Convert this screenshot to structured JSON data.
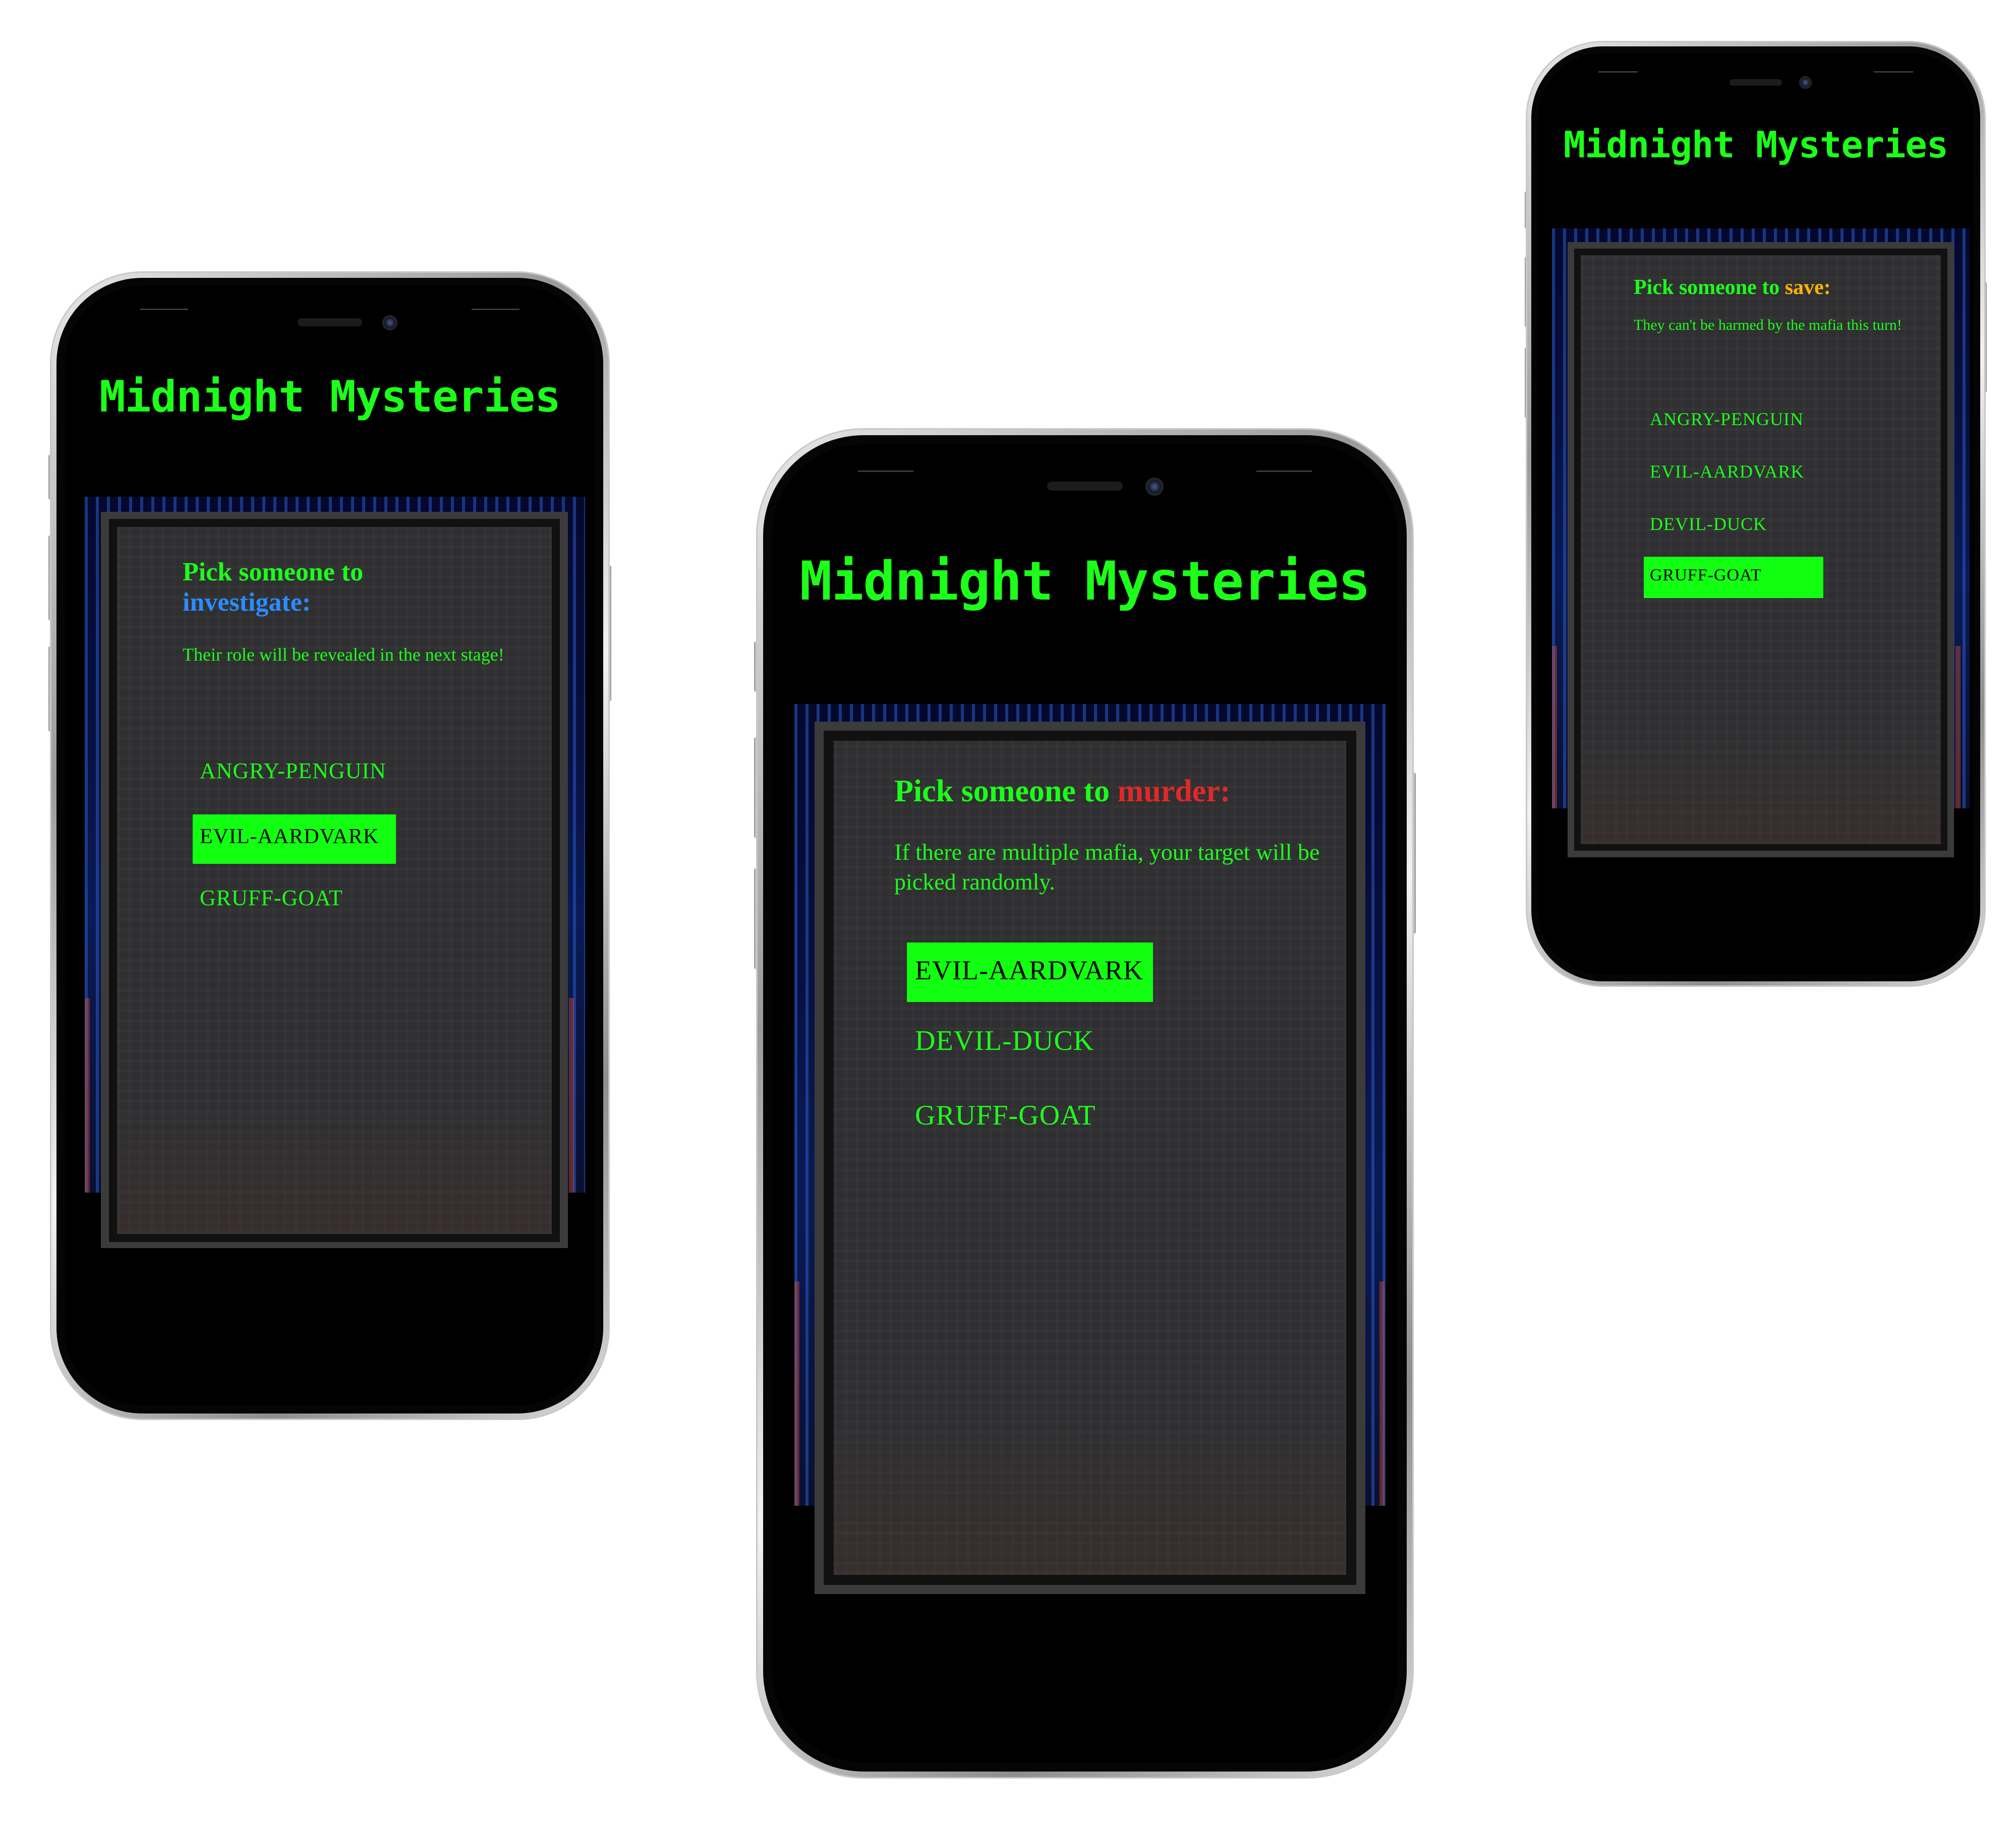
{
  "app": {
    "title": "Midnight Mysteries"
  },
  "screens": {
    "investigate": {
      "prompt": "Pick someone to",
      "action": "investigate:",
      "description": "Their role will be revealed in the next stage!",
      "players": [
        "ANGRY-PENGUIN",
        "EVIL-AARDVARK",
        "GRUFF-GOAT"
      ],
      "selected_player": "EVIL-AARDVARK"
    },
    "murder": {
      "prompt": "Pick someone to",
      "action": "murder:",
      "description": "If there are multiple mafia, your target will be picked randomly.",
      "players": [
        "EVIL-AARDVARK",
        "DEVIL-DUCK",
        "GRUFF-GOAT"
      ],
      "selected_player": "EVIL-AARDVARK"
    },
    "save": {
      "prompt": "Pick someone to",
      "action": "save:",
      "description": "They can't be harmed by the mafia this turn!",
      "players": [
        "ANGRY-PENGUIN",
        "EVIL-AARDVARK",
        "DEVIL-DUCK",
        "GRUFF-GOAT"
      ],
      "selected_player": "GRUFF-GOAT"
    }
  },
  "colors": {
    "accent_green": "#1dff1a",
    "selected_bg": "#12ff12",
    "investigate": "#2b8cff",
    "murder": "#e02828",
    "save": "#ffb400",
    "panel": "#2f2f31"
  },
  "icons": [
    "front-camera-icon",
    "speaker-grille-icon"
  ]
}
